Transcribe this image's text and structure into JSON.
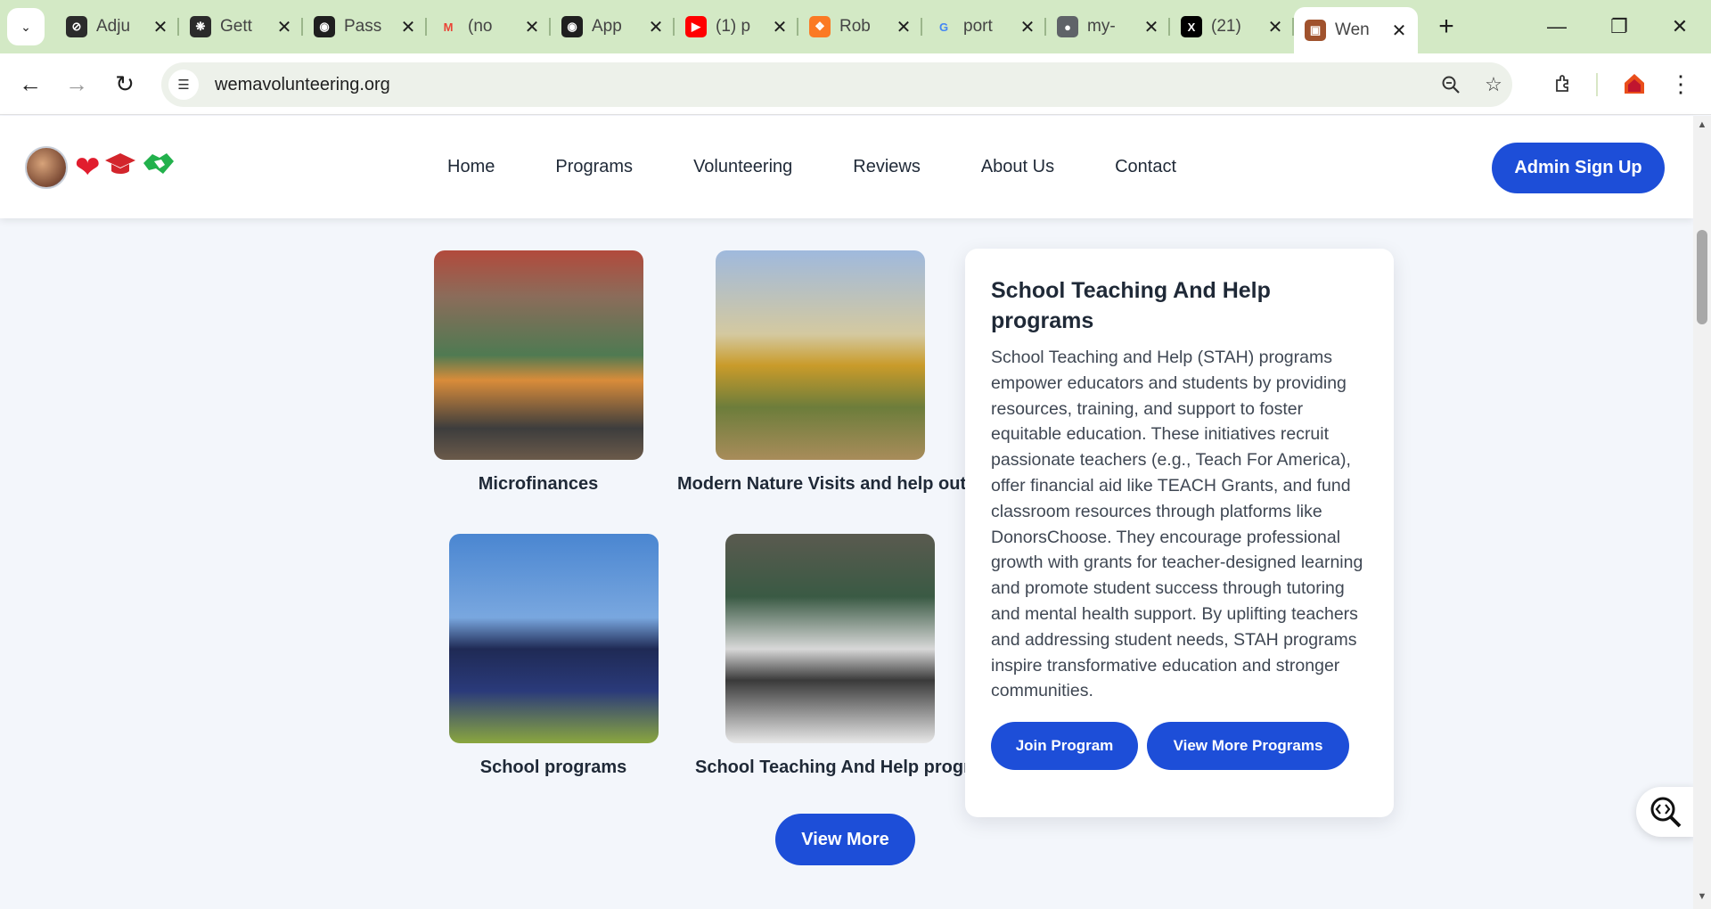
{
  "browser": {
    "tabs": [
      {
        "title": "Adju",
        "icon": "sync-icon",
        "color": "#2b2b2b"
      },
      {
        "title": "Gett",
        "icon": "openai-icon",
        "color": "#2b2b2b"
      },
      {
        "title": "Pass",
        "icon": "github-icon",
        "color": "#1f1f1f"
      },
      {
        "title": "(no",
        "icon": "gmail-icon",
        "color": "#ea4335"
      },
      {
        "title": "App",
        "icon": "github-icon",
        "color": "#1f1f1f"
      },
      {
        "title": "(1) p",
        "icon": "youtube-icon",
        "color": "#ff0000"
      },
      {
        "title": "Rob",
        "icon": "xampp-icon",
        "color": "#fb7a24"
      },
      {
        "title": "port",
        "icon": "google-icon",
        "color": "#4285f4"
      },
      {
        "title": "my-",
        "icon": "globe-icon",
        "color": "#5f6368"
      },
      {
        "title": "(21)",
        "icon": "x-icon",
        "color": "#000000"
      },
      {
        "title": "Wen",
        "icon": "site-icon",
        "color": "#a0522d",
        "active": true
      }
    ],
    "url": "wemavolunteering.org"
  },
  "header": {
    "nav": [
      "Home",
      "Programs",
      "Volunteering",
      "Reviews",
      "About Us",
      "Contact"
    ],
    "admin_button": "Admin Sign Up"
  },
  "programs": [
    {
      "caption": "Microfinances"
    },
    {
      "caption": "Modern Nature Visits and help out"
    },
    {
      "caption": "School programs"
    },
    {
      "caption": "School Teaching And Help progra"
    }
  ],
  "detail": {
    "title": "School Teaching And Help programs",
    "body": "School Teaching and Help (STAH) programs empower educators and students by providing resources, training, and support to foster equitable education. These initiatives recruit passionate teachers (e.g., Teach For America), offer financial aid like TEACH Grants, and fund classroom resources through platforms like DonorsChoose. They encourage professional growth with grants for teacher-designed learning and promote student success through tutoring and mental health support. By uplifting teachers and addressing student needs, STAH programs inspire transformative education and stronger communities.",
    "join_button": "Join Program",
    "more_button": "View More Programs"
  },
  "view_more": "View More",
  "colors": {
    "accent": "#1d4ed8",
    "tabbar": "#d3e9c5"
  }
}
